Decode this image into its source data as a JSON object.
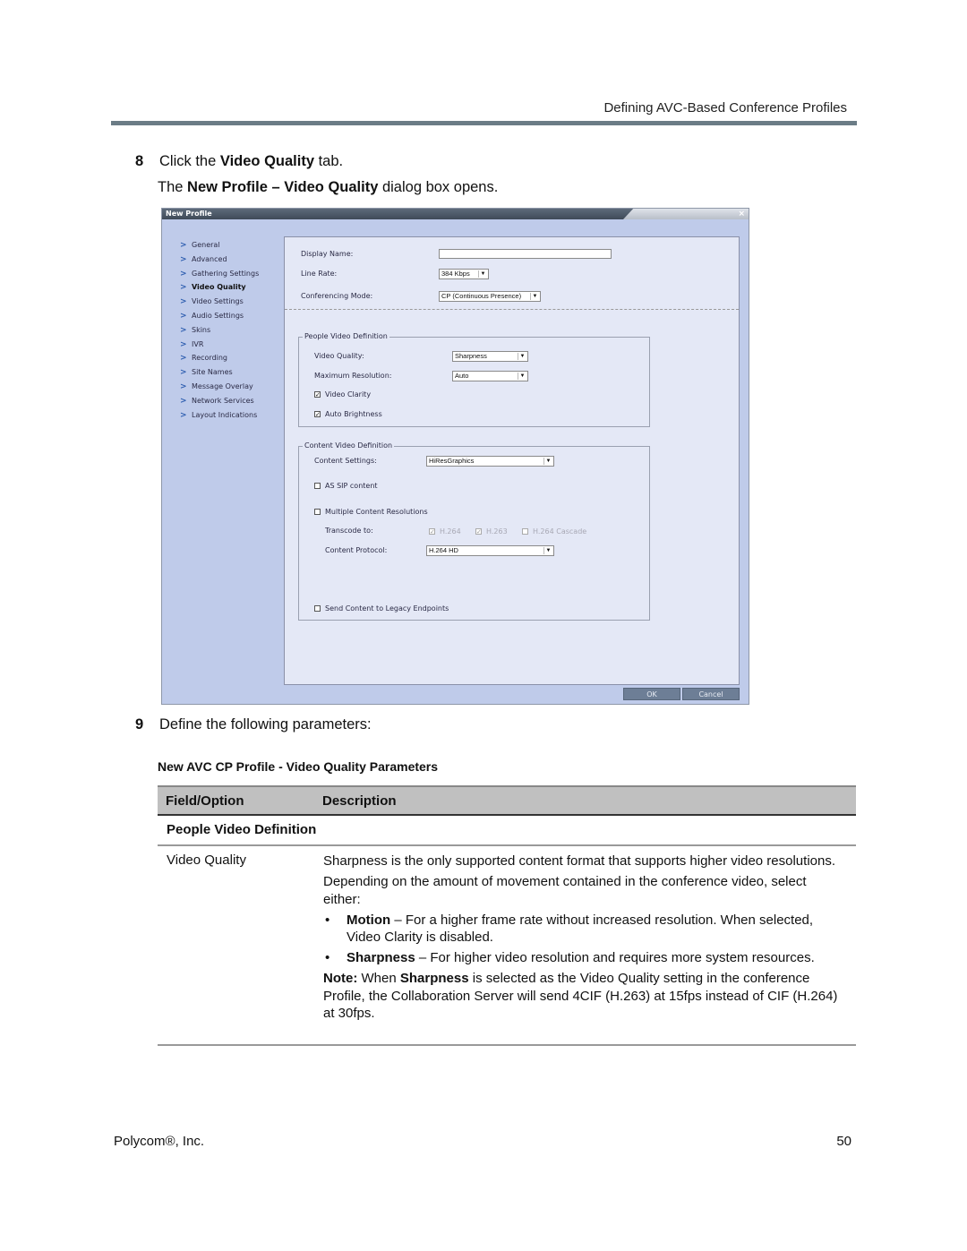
{
  "header": {
    "running_title": "Defining AVC-Based Conference Profiles"
  },
  "step8": {
    "number": "8",
    "pre": "Click the ",
    "bold": "Video Quality",
    "post": " tab.",
    "sub_pre": "The ",
    "sub_bold": "New Profile – Video Quality",
    "sub_post": " dialog box opens."
  },
  "dialog": {
    "title": "New Profile",
    "close": "×",
    "nav": [
      {
        "label": "General"
      },
      {
        "label": "Advanced"
      },
      {
        "label": "Gathering Settings"
      },
      {
        "label": "Video Quality",
        "active": true
      },
      {
        "label": "Video Settings"
      },
      {
        "label": "Audio Settings"
      },
      {
        "label": "Skins"
      },
      {
        "label": "IVR"
      },
      {
        "label": "Recording"
      },
      {
        "label": "Site Names"
      },
      {
        "label": "Message Overlay"
      },
      {
        "label": "Network Services"
      },
      {
        "label": "Layout Indications"
      }
    ],
    "display_name_label": "Display Name:",
    "display_name_value": "",
    "line_rate_label": "Line Rate:",
    "line_rate_value": "384 Kbps",
    "conf_mode_label": "Conferencing Mode:",
    "conf_mode_value": "CP (Continuous Presence)",
    "people": {
      "title": "People Video Definition",
      "video_quality_label": "Video Quality:",
      "video_quality_value": "Sharpness",
      "max_res_label": "Maximum Resolution:",
      "max_res_value": "Auto",
      "video_clarity_label": "Video Clarity",
      "video_clarity_checked": true,
      "auto_brightness_label": "Auto Brightness",
      "auto_brightness_checked": true
    },
    "content": {
      "title": "Content Video Definition",
      "settings_label": "Content Settings:",
      "settings_value": "HiResGraphics",
      "as_sip_label": "AS SIP content",
      "as_sip_checked": false,
      "multi_res_label": "Multiple Content Resolutions",
      "multi_res_checked": false,
      "transcode_label": "Transcode to:",
      "transcode_h264": "H.264",
      "transcode_h263": "H.263",
      "transcode_cascade": "H.264 Cascade",
      "protocol_label": "Content Protocol:",
      "protocol_value": "H.264 HD",
      "legacy_label": "Send Content to Legacy Endpoints",
      "legacy_checked": false
    },
    "ok": "OK",
    "cancel": "Cancel",
    "check_glyph": "✓",
    "arrow_glyph": "▼",
    "chevron_glyph": ">"
  },
  "step9": {
    "number": "9",
    "text": "Define the following parameters:"
  },
  "table": {
    "caption": "New AVC CP Profile - Video Quality Parameters",
    "headers": [
      "Field/Option",
      "Description"
    ],
    "group": "People Video Definition",
    "rows": [
      {
        "field": "Video Quality",
        "p1": "Sharpness is the only supported content format that supports higher video resolutions.",
        "p2": "Depending on the amount of movement contained in the conference video, select either:",
        "b1_bold": "Motion",
        "b1_text": " – For a higher frame rate without increased resolution. When selected, Video Clarity is disabled.",
        "b2_bold": "Sharpness",
        "b2_text": " – For higher video resolution and requires more system resources.",
        "note_bold": "Note:",
        "note_mid": " When ",
        "note_bold2": "Sharpness",
        "note_text": " is selected as the Video Quality setting in the conference Profile, the Collaboration Server will send 4CIF (H.263) at 15fps instead of CIF (H.264) at 30fps."
      }
    ]
  },
  "footer": {
    "company": "Polycom®, Inc.",
    "page": "50"
  }
}
